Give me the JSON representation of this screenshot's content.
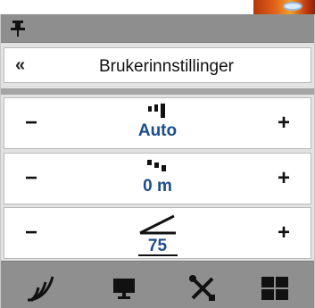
{
  "map": {
    "blip_color": "#d9ecff"
  },
  "panel": {
    "pin_icon": "pin-icon",
    "header": {
      "back_label": "«",
      "title": "Brukerinnstillinger"
    },
    "rows": [
      {
        "icon": "signal-bars-icon",
        "minus": "−",
        "value": "Auto",
        "plus": "+"
      },
      {
        "icon": "bars-offset-icon",
        "minus": "−",
        "value": "0 m",
        "plus": "+"
      },
      {
        "icon": "angle-icon",
        "minus": "−",
        "value": "75",
        "plus": "+"
      }
    ],
    "toolbar": [
      {
        "icon": "sonar-waves-icon"
      },
      {
        "icon": "monitor-icon"
      },
      {
        "icon": "tools-icon"
      },
      {
        "icon": "grid-layout-icon"
      }
    ]
  },
  "colors": {
    "value_text": "#1e4d8c",
    "panel_bg": "#e2e2e2",
    "bar_gray": "#8e8e8e"
  }
}
